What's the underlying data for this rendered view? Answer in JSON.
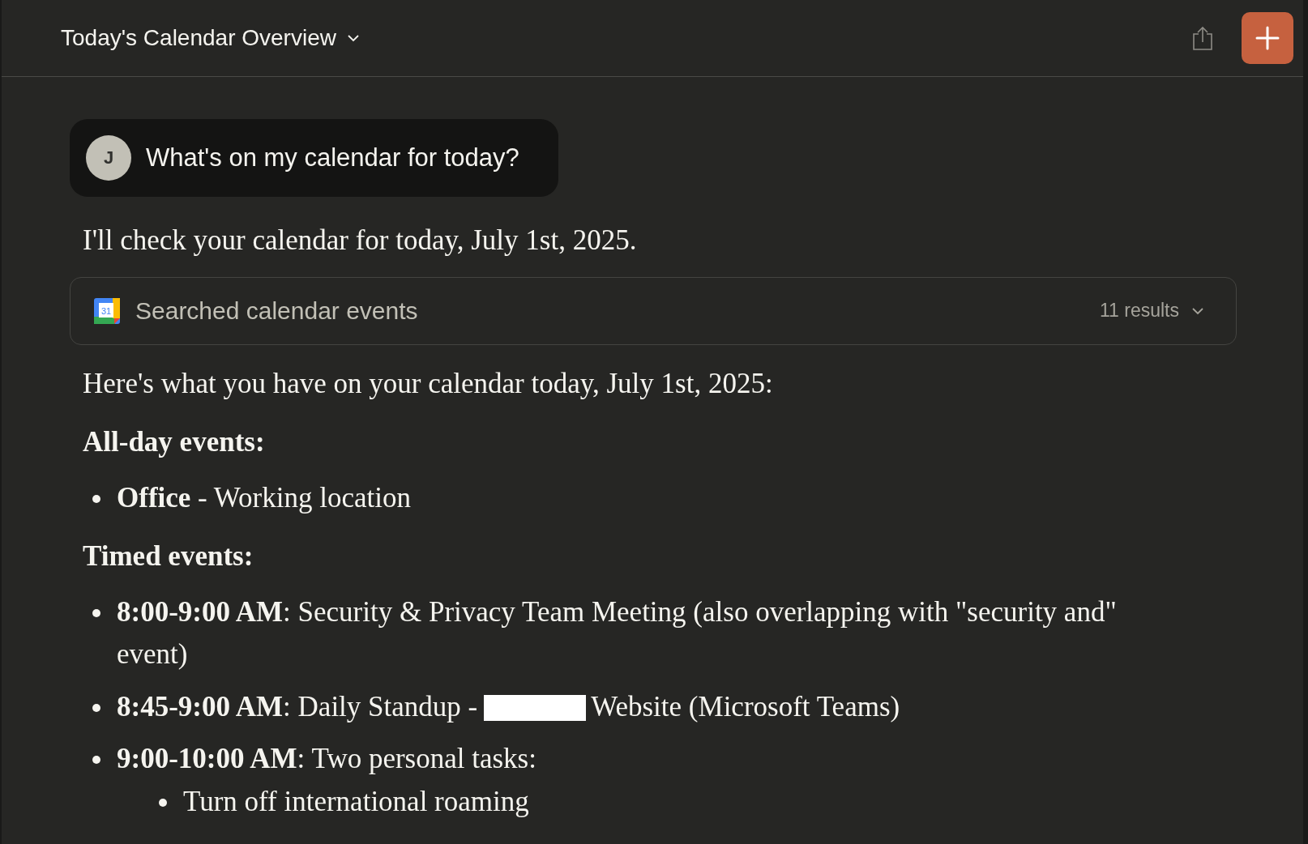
{
  "header": {
    "title": "Today's Calendar Overview"
  },
  "user_message": {
    "avatar": "J",
    "text": "What's on my calendar for today?"
  },
  "intro": "I'll check your calendar for today, July 1st, 2025.",
  "tool_call": {
    "icon_text": "31",
    "label": "Searched calendar events",
    "count": "11 results",
    "expanded": false
  },
  "answer_intro": "Here's what you have on your calendar today, July 1st, 2025:",
  "sections": [
    {
      "heading": "All-day events:",
      "items": [
        {
          "text": "**Office** - Working location",
          "redacted": false
        }
      ]
    },
    {
      "heading": "Timed events:",
      "items": [
        {
          "text": "**8:00-9:00 AM**: Security & Privacy Team Meeting (also overlapping with \"security and\" event)",
          "redacted": false
        },
        {
          "text": "**8:45-9:00 AM**: Daily Standup -",
          "redacted": true,
          "text_after": "Website (Microsoft Teams)"
        },
        {
          "text": "**9:00-10:00 AM**: Two personal tasks:",
          "redacted": false,
          "children": [
            {
              "text": "Turn off international roaming",
              "redacted": false
            }
          ]
        }
      ]
    }
  ]
}
